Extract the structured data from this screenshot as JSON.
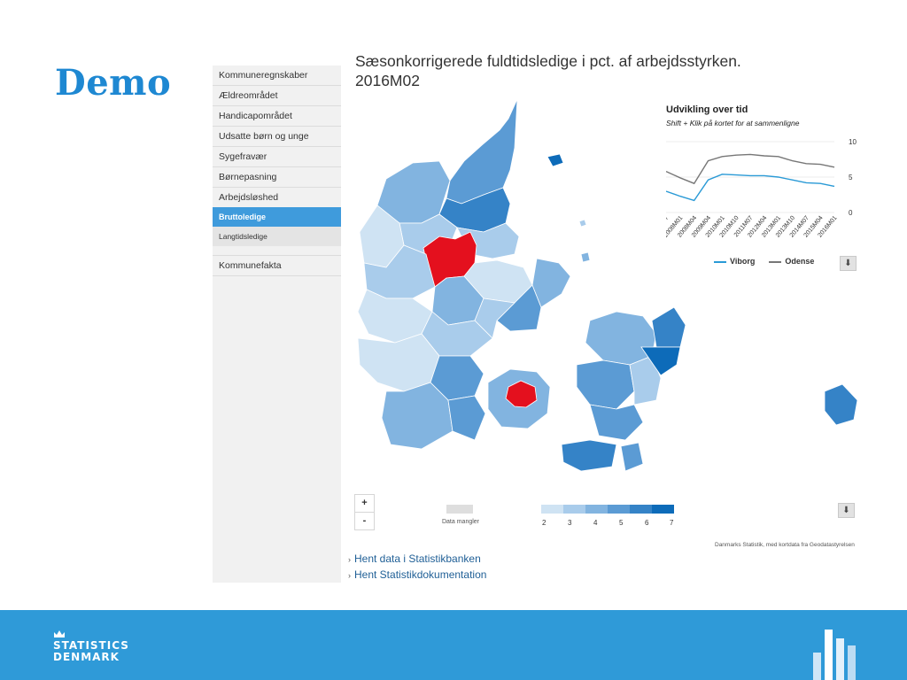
{
  "slide": {
    "title": "Demo"
  },
  "sidebar": {
    "items": [
      {
        "label": "Kommuneregnskaber"
      },
      {
        "label": "Ældreområdet"
      },
      {
        "label": "Handicapområdet"
      },
      {
        "label": "Udsatte børn og unge"
      },
      {
        "label": "Sygefravær"
      },
      {
        "label": "Børnepasning"
      },
      {
        "label": "Arbejdsløshed"
      }
    ],
    "active_item": "Bruttoledige",
    "sub_item": "Langtidsledige",
    "bottom_item": "Kommunefakta"
  },
  "map": {
    "title_line1": "Sæsonkorrigerede fuldtidsledige i pct. af arbejdsstyrken.",
    "title_line2": "2016M02",
    "zoom_in": "+",
    "zoom_out": "-",
    "no_data_label": "Data mangler",
    "scale_labels": [
      "2",
      "3",
      "4",
      "5",
      "6",
      "7"
    ],
    "scale_colors": [
      "#cfe3f3",
      "#a9cceb",
      "#82b4e0",
      "#5b9bd4",
      "#3583c7",
      "#0d6bb9"
    ],
    "highlight_color": "#e4101e",
    "attribution": "Danmarks Statistik, med kortdata fra Geodatastyrelsen"
  },
  "chart": {
    "title": "Udvikling over tid",
    "subtitle": "Shift + Klik på kortet for at sammenligne",
    "y_ticks": [
      "10",
      "5",
      "0"
    ],
    "x_labels": [
      "2007",
      "2008M01",
      "2008M04",
      "2009M04",
      "2010M01",
      "2010M10",
      "2011M07",
      "2012M04",
      "2013M01",
      "2013M10",
      "2014M07",
      "2015M04",
      "2016M01"
    ],
    "legend": [
      {
        "name": "Viborg",
        "color": "#2a9ad6"
      },
      {
        "name": "Odense",
        "color": "#777777"
      }
    ]
  },
  "links": [
    {
      "label": "Hent data i Statistikbanken"
    },
    {
      "label": "Hent Statistikdokumentation"
    }
  ],
  "footer": {
    "brand_line1": "STATISTICS",
    "brand_line2": "DENMARK"
  },
  "chart_data": {
    "type": "line",
    "title": "Udvikling over tid",
    "x": [
      "2007",
      "2008M01",
      "2008M04",
      "2009M04",
      "2010M01",
      "2010M10",
      "2011M07",
      "2012M04",
      "2013M01",
      "2013M10",
      "2014M07",
      "2015M04",
      "2016M01"
    ],
    "ylim": [
      0,
      10
    ],
    "y_ticks": [
      0,
      5,
      10
    ],
    "series": [
      {
        "name": "Viborg",
        "values": [
          3.0,
          2.3,
          1.7,
          4.6,
          5.4,
          5.3,
          5.2,
          5.2,
          5.0,
          4.6,
          4.2,
          4.1,
          3.7
        ]
      },
      {
        "name": "Odense",
        "values": [
          5.8,
          4.9,
          4.1,
          7.3,
          7.9,
          8.1,
          8.2,
          8.0,
          7.9,
          7.3,
          6.9,
          6.8,
          6.4
        ]
      }
    ],
    "grid": true,
    "legend_position": "bottom"
  }
}
